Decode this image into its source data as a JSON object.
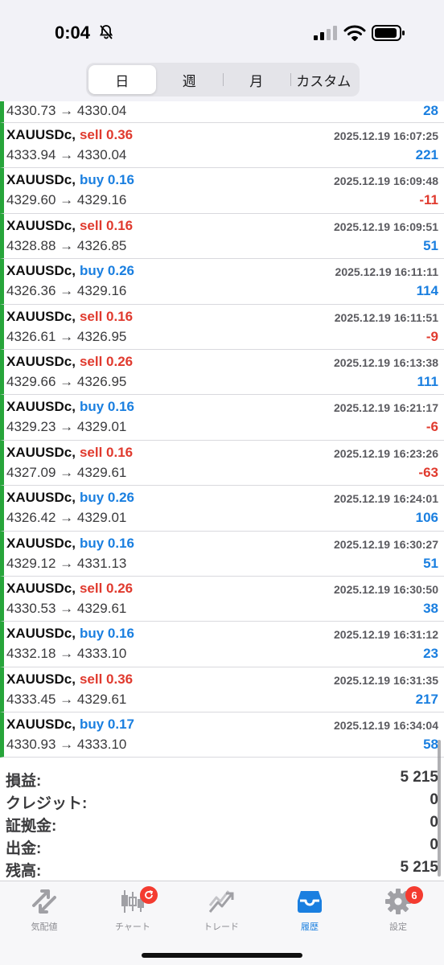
{
  "status_bar": {
    "time": "0:04",
    "icons": [
      "bell-slash-icon",
      "signal-icon",
      "wifi-icon",
      "battery-icon"
    ]
  },
  "period_tabs": {
    "items": [
      "日",
      "週",
      "月",
      "カスタム"
    ],
    "selected": "日"
  },
  "colors": {
    "buy": "#1a7fe0",
    "sell": "#e03a2e",
    "row_marker": "#27a53a",
    "active_tab": "#1a7fe0",
    "badge": "#f43b30"
  },
  "first_row": {
    "prices": "4330.73 → 4330.04",
    "profit": "28",
    "sign": "pos"
  },
  "deals": [
    {
      "symbol": "XAUUSDc,",
      "side": "sell 0.36",
      "type": "sell",
      "time": "2025.12.19 16:07:25",
      "prices": "4333.94 → 4330.04",
      "profit": "221",
      "sign": "pos"
    },
    {
      "symbol": "XAUUSDc,",
      "side": "buy 0.16",
      "type": "buy",
      "time": "2025.12.19 16:09:48",
      "prices": "4329.60 → 4329.16",
      "profit": "-11",
      "sign": "neg"
    },
    {
      "symbol": "XAUUSDc,",
      "side": "sell 0.16",
      "type": "sell",
      "time": "2025.12.19 16:09:51",
      "prices": "4328.88 → 4326.85",
      "profit": "51",
      "sign": "pos"
    },
    {
      "symbol": "XAUUSDc,",
      "side": "buy 0.26",
      "type": "buy",
      "time": "2025.12.19 16:11:11",
      "prices": "4326.36 → 4329.16",
      "profit": "114",
      "sign": "pos"
    },
    {
      "symbol": "XAUUSDc,",
      "side": "sell 0.16",
      "type": "sell",
      "time": "2025.12.19 16:11:51",
      "prices": "4326.61 → 4326.95",
      "profit": "-9",
      "sign": "neg"
    },
    {
      "symbol": "XAUUSDc,",
      "side": "sell 0.26",
      "type": "sell",
      "time": "2025.12.19 16:13:38",
      "prices": "4329.66 → 4326.95",
      "profit": "111",
      "sign": "pos"
    },
    {
      "symbol": "XAUUSDc,",
      "side": "buy 0.16",
      "type": "buy",
      "time": "2025.12.19 16:21:17",
      "prices": "4329.23 → 4329.01",
      "profit": "-6",
      "sign": "neg"
    },
    {
      "symbol": "XAUUSDc,",
      "side": "sell 0.16",
      "type": "sell",
      "time": "2025.12.19 16:23:26",
      "prices": "4327.09 → 4329.61",
      "profit": "-63",
      "sign": "neg"
    },
    {
      "symbol": "XAUUSDc,",
      "side": "buy 0.26",
      "type": "buy",
      "time": "2025.12.19 16:24:01",
      "prices": "4326.42 → 4329.01",
      "profit": "106",
      "sign": "pos"
    },
    {
      "symbol": "XAUUSDc,",
      "side": "buy 0.16",
      "type": "buy",
      "time": "2025.12.19 16:30:27",
      "prices": "4329.12 → 4331.13",
      "profit": "51",
      "sign": "pos"
    },
    {
      "symbol": "XAUUSDc,",
      "side": "sell 0.26",
      "type": "sell",
      "time": "2025.12.19 16:30:50",
      "prices": "4330.53 → 4329.61",
      "profit": "38",
      "sign": "pos"
    },
    {
      "symbol": "XAUUSDc,",
      "side": "buy 0.16",
      "type": "buy",
      "time": "2025.12.19 16:31:12",
      "prices": "4332.18 → 4333.10",
      "profit": "23",
      "sign": "pos"
    },
    {
      "symbol": "XAUUSDc,",
      "side": "sell 0.36",
      "type": "sell",
      "time": "2025.12.19 16:31:35",
      "prices": "4333.45 → 4329.61",
      "profit": "217",
      "sign": "pos"
    },
    {
      "symbol": "XAUUSDc,",
      "side": "buy 0.17",
      "type": "buy",
      "time": "2025.12.19 16:34:04",
      "prices": "4330.93 → 4333.10",
      "profit": "58",
      "sign": "pos"
    }
  ],
  "summary": [
    {
      "label": "損益:",
      "value": "5 215"
    },
    {
      "label": "クレジット:",
      "value": "0"
    },
    {
      "label": "証拠金:",
      "value": "0"
    },
    {
      "label": "出金:",
      "value": "0"
    },
    {
      "label": "残高:",
      "value": "5 215"
    }
  ],
  "tabbar": {
    "items": [
      {
        "label": "気配値",
        "icon": "quotes-arrows-icon"
      },
      {
        "label": "チャート",
        "icon": "candlestick-chart-icon",
        "badge_icon": "refresh-icon"
      },
      {
        "label": "トレード",
        "icon": "trade-chart-icon"
      },
      {
        "label": "履歴",
        "icon": "history-inbox-icon",
        "active": true
      },
      {
        "label": "設定",
        "icon": "gear-icon",
        "badge": "6"
      }
    ]
  }
}
